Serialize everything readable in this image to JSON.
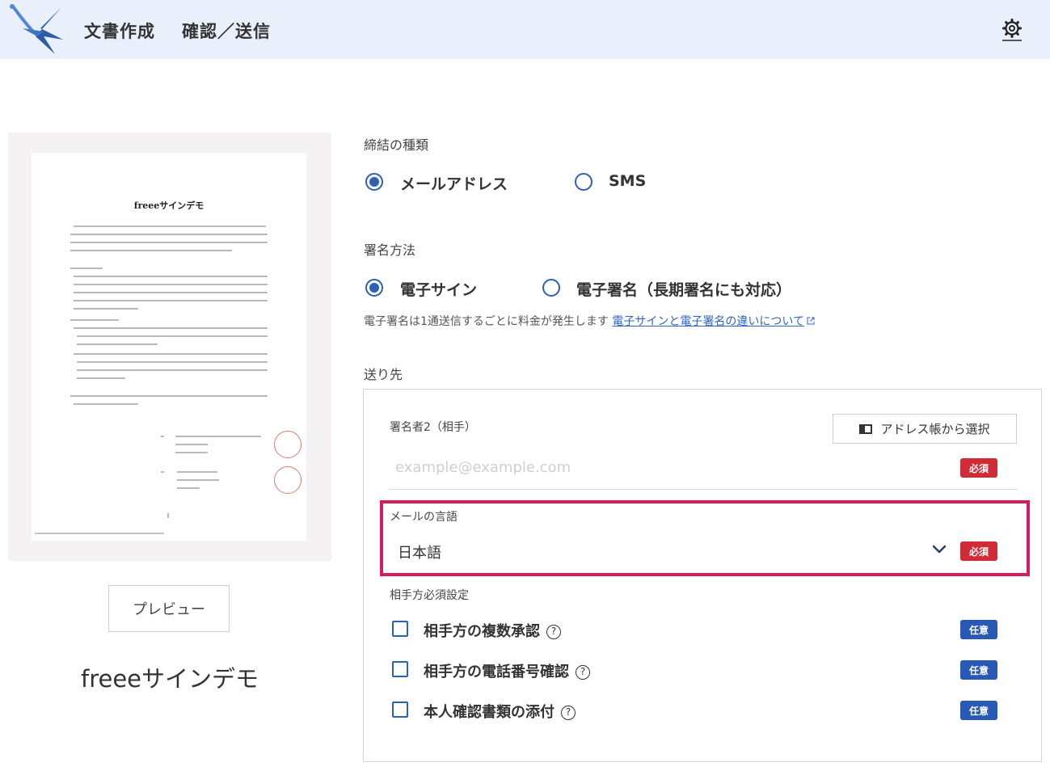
{
  "header": {
    "crumb_current": "文書作成",
    "crumb_next": "確認／送信",
    "settings_icon": "gear-icon"
  },
  "preview": {
    "document_title": "freeeサインデモ",
    "preview_button": "プレビュー",
    "document_name": "freeeサインデモ"
  },
  "form": {
    "contract_type": {
      "label": "締結の種類",
      "options": [
        {
          "label": "メールアドレス",
          "selected": true
        },
        {
          "label": "SMS",
          "selected": false
        }
      ]
    },
    "signing_method": {
      "label": "署名方法",
      "options": [
        {
          "label": "電子サイン",
          "selected": true
        },
        {
          "label": "電子署名（長期署名にも対応）",
          "selected": false
        }
      ],
      "note": "電子署名は1通送信するごとに料金が発生します",
      "note_link": "電子サインと電子署名の違いについて"
    },
    "destination": {
      "label": "送り先",
      "signer_label": "署名者2（相手）",
      "address_book_button": "アドレス帳から選択",
      "email_placeholder": "example@example.com",
      "required_badge": "必須",
      "language_label": "メールの言語",
      "language_value": "日本語",
      "recipient_settings_label": "相手方必須設定",
      "optional_badge": "任意",
      "checkboxes": [
        {
          "label": "相手方の複数承認",
          "checked": false
        },
        {
          "label": "相手方の電話番号確認",
          "checked": false
        },
        {
          "label": "本人確認書類の添付",
          "checked": false
        }
      ]
    }
  },
  "colors": {
    "header_bg": "#e9f0fb",
    "accent": "#2c5fb8",
    "required": "#d12b36",
    "optional": "#2859b6",
    "highlight": "#d81b60"
  }
}
